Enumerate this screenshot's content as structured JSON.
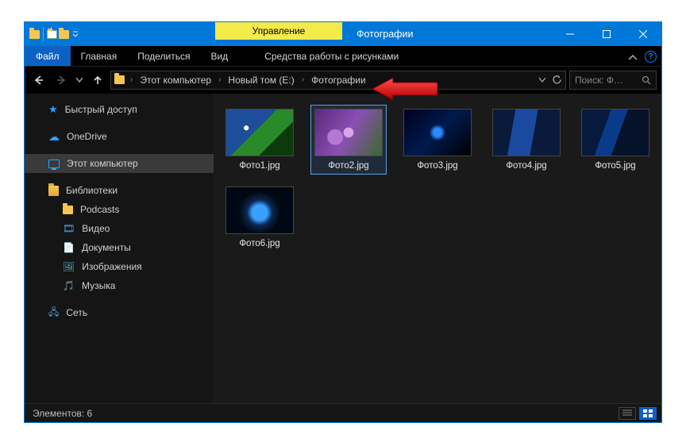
{
  "titlebar": {
    "context_tab": "Управление",
    "title": "Фотографии"
  },
  "ribbon": {
    "file": "Файл",
    "tabs": [
      "Главная",
      "Поделиться",
      "Вид"
    ],
    "context_tab": "Средства работы с рисунками"
  },
  "nav": {
    "breadcrumb": [
      "Этот компьютер",
      "Новый том (E:)",
      "Фотографии"
    ],
    "search_placeholder": "Поиск: Ф…"
  },
  "sidebar": {
    "quick_access": "Быстрый доступ",
    "onedrive": "OneDrive",
    "this_pc": "Этот компьютер",
    "libraries": "Библиотеки",
    "lib_items": [
      "Podcasts",
      "Видео",
      "Документы",
      "Изображения",
      "Музыка"
    ],
    "network": "Сеть"
  },
  "files": [
    {
      "name": "Фото1.jpg",
      "selected": false,
      "thumb": "t1"
    },
    {
      "name": "Фото2.jpg",
      "selected": true,
      "thumb": "t2"
    },
    {
      "name": "Фото3.jpg",
      "selected": false,
      "thumb": "t3"
    },
    {
      "name": "Фото4.jpg",
      "selected": false,
      "thumb": "t4"
    },
    {
      "name": "Фото5.jpg",
      "selected": false,
      "thumb": "t5"
    },
    {
      "name": "Фото6.jpg",
      "selected": false,
      "thumb": "t6"
    }
  ],
  "status": {
    "count_label": "Элементов: 6"
  }
}
